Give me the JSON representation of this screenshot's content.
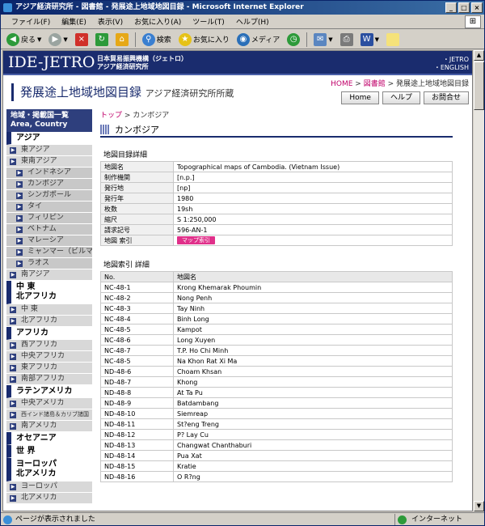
{
  "window": {
    "title": "アジア経済研究所 - 図書館 - 発展途上地域地図目録 - Microsoft Internet Explorer"
  },
  "menu": [
    "ファイル(F)",
    "編集(E)",
    "表示(V)",
    "お気に入り(A)",
    "ツール(T)",
    "ヘルプ(H)"
  ],
  "toolbar": {
    "back": "戻る",
    "search": "検索",
    "favorites": "お気に入り",
    "media": "メディア"
  },
  "header": {
    "logo": "IDE-JETRO",
    "org_line1": "日本貿易振興機構（ジェトロ）",
    "org_line2": "アジア経済研究所",
    "lang_line1": "・JETRO",
    "lang_line2": "・ENGLISH"
  },
  "breadcrumb_top": {
    "home": "HOME",
    "sep1": " > ",
    "lib": "図書館",
    "sep2": " > ",
    "current": "発展途上地域地図目録"
  },
  "page_title": {
    "main": "発展途上地域地図目録",
    "sub": "アジア経済研究所所蔵"
  },
  "nav": {
    "home": "Home",
    "help": "ヘルプ",
    "contact": "お問合せ"
  },
  "sidebar": {
    "head_line1": "地域・掲載国一覧",
    "head_line2": "Area, Country",
    "items": [
      {
        "t": "cat",
        "label": "アジア"
      },
      {
        "t": "sub",
        "label": "東アジア"
      },
      {
        "t": "sub",
        "label": "東南アジア"
      },
      {
        "t": "sub2",
        "label": "インドネシア"
      },
      {
        "t": "sub2",
        "label": "カンボジア"
      },
      {
        "t": "sub2",
        "label": "シンガポール"
      },
      {
        "t": "sub2",
        "label": "タイ"
      },
      {
        "t": "sub2",
        "label": "フィリピン"
      },
      {
        "t": "sub2",
        "label": "ベトナム"
      },
      {
        "t": "sub2",
        "label": "マレーシア"
      },
      {
        "t": "sub2",
        "label": "ミャンマー（ビルマ）"
      },
      {
        "t": "sub2",
        "label": "ラオス"
      },
      {
        "t": "sub",
        "label": "南アジア"
      },
      {
        "t": "cat2",
        "label1": "中 東",
        "label2": "北アフリカ"
      },
      {
        "t": "sub",
        "label": "中 東"
      },
      {
        "t": "sub",
        "label": "北アフリカ"
      },
      {
        "t": "cat",
        "label": "アフリカ"
      },
      {
        "t": "sub",
        "label": "西アフリカ"
      },
      {
        "t": "sub",
        "label": "中央アフリカ"
      },
      {
        "t": "sub",
        "label": "東アフリカ"
      },
      {
        "t": "sub",
        "label": "南部アフリカ"
      },
      {
        "t": "cat",
        "label": "ラテンアメリカ"
      },
      {
        "t": "sub",
        "label": "中央アメリカ"
      },
      {
        "t": "subsmall",
        "label": "西インド諸島＆カリブ諸国"
      },
      {
        "t": "sub",
        "label": "南アメリカ"
      },
      {
        "t": "cat",
        "label": "オセアニア"
      },
      {
        "t": "cat",
        "label": "世 界"
      },
      {
        "t": "cat2",
        "label1": "ヨーロッパ",
        "label2": "北アメリカ"
      },
      {
        "t": "sub",
        "label": "ヨーロッパ"
      },
      {
        "t": "sub",
        "label": "北アメリカ"
      }
    ]
  },
  "content": {
    "crumb_top": "トップ",
    "crumb_sep": " > ",
    "crumb_current": "カンボジア",
    "heading": "カンボジア",
    "detail_label": "地図目録詳細",
    "details": [
      {
        "k": "地図名",
        "v": "Topographical maps of Cambodia. (Vietnam Issue)"
      },
      {
        "k": "制作機関",
        "v": "[n.p.]"
      },
      {
        "k": "発行地",
        "v": "[np]"
      },
      {
        "k": "発行年",
        "v": "1980"
      },
      {
        "k": "枚数",
        "v": "19sh"
      },
      {
        "k": "縮尺",
        "v": "S 1:250,000"
      },
      {
        "k": "請求記号",
        "v": "596-AN-1"
      },
      {
        "k": "地図 索引",
        "v": "",
        "button": "マップ索引"
      }
    ],
    "index_label": "地図索引 詳細",
    "index_headers": [
      "No.",
      "地図名"
    ],
    "index_rows": [
      [
        "NC-48-1",
        "Krong Khemarak Phoumin"
      ],
      [
        "NC-48-2",
        "Nong Penh"
      ],
      [
        "NC-48-3",
        "Tay Ninh"
      ],
      [
        "NC-48-4",
        "Binh Long"
      ],
      [
        "NC-48-5",
        "Kampot"
      ],
      [
        "NC-48-6",
        "Long Xuyen"
      ],
      [
        "NC-48-7",
        "T.P. Ho Chi Minh"
      ],
      [
        "NC-48-5",
        "Na Khon Rat Xi Ma"
      ],
      [
        "ND-48-6",
        "Choam Khsan"
      ],
      [
        "ND-48-7",
        "Khong"
      ],
      [
        "ND-48-8",
        "At Ta Pu"
      ],
      [
        "ND-48-9",
        "Batdambang"
      ],
      [
        "ND-48-10",
        "Siemreap"
      ],
      [
        "ND-48-11",
        "St?eng Treng"
      ],
      [
        "ND-48-12",
        "P? Lay Cu"
      ],
      [
        "ND-48-13",
        "Changwat Chanthaburi"
      ],
      [
        "ND-48-14",
        "Pua Xat"
      ],
      [
        "ND-48-15",
        "Kratie"
      ],
      [
        "ND-48-16",
        "O R?ng"
      ]
    ]
  },
  "status": {
    "left": "ページが表示されました",
    "right": "インターネット"
  }
}
